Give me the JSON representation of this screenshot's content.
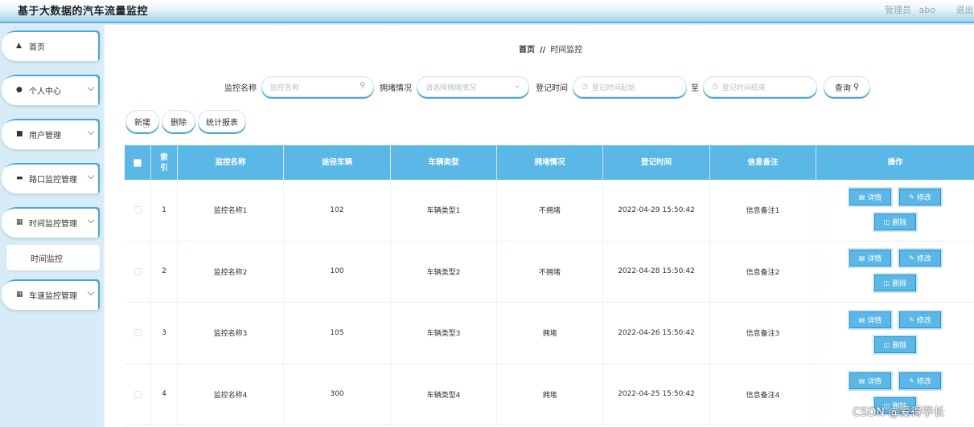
{
  "header": {
    "app_title": "基于大数据的汽车流量监控",
    "user_role": "管理员",
    "username": "abo",
    "logout": "退出登"
  },
  "sidebar": {
    "items": [
      {
        "label": "首页",
        "icon": "home-icon"
      },
      {
        "label": "个人中心",
        "icon": "person-icon"
      },
      {
        "label": "用户管理",
        "icon": "briefcase-icon"
      },
      {
        "label": "路口监控管理",
        "icon": "camera-icon"
      },
      {
        "label": "时间监控管理",
        "icon": "grid-icon"
      },
      {
        "label": "车速监控管理",
        "icon": "grid-icon"
      }
    ],
    "sub_item": "时间监控"
  },
  "breadcrumb": {
    "home": "首页",
    "separator": "//",
    "current": "时间监控"
  },
  "search": {
    "name_label": "监控名称",
    "name_placeholder": "监控名称",
    "congestion_label": "拥堵情况",
    "congestion_placeholder": "请选择拥堵情况",
    "time_label": "登记时间",
    "start_placeholder": "登记时间起始",
    "to": "至",
    "end_placeholder": "登记时间结束",
    "query": "查询"
  },
  "actions": {
    "add": "新增",
    "delete": "删除",
    "report": "统计报表"
  },
  "table": {
    "headers": [
      "索引",
      "监控名称",
      "途径车辆",
      "车辆类型",
      "拥堵情况",
      "登记时间",
      "信息备注",
      "操作"
    ],
    "rows": [
      {
        "index": "1",
        "name": "监控名称1",
        "vehicles": "102",
        "type": "车辆类型1",
        "congestion": "不拥堵",
        "time": "2022-04-29 15:50:42",
        "note": "信息备注1"
      },
      {
        "index": "2",
        "name": "监控名称2",
        "vehicles": "100",
        "type": "车辆类型2",
        "congestion": "不拥堵",
        "time": "2022-04-28 15:50:42",
        "note": "信息备注2"
      },
      {
        "index": "3",
        "name": "监控名称3",
        "vehicles": "105",
        "type": "车辆类型3",
        "congestion": "拥堵",
        "time": "2022-04-26 15:50:42",
        "note": "信息备注3"
      },
      {
        "index": "4",
        "name": "监控名称4",
        "vehicles": "300",
        "type": "车辆类型4",
        "congestion": "拥堵",
        "time": "2022-04-25 15:50:42",
        "note": "信息备注4"
      }
    ],
    "op_detail": "详情",
    "op_edit": "修改",
    "op_delete": "删除"
  },
  "watermark": "CSDN @爱得学长",
  "colors": {
    "accent": "#5bb7e5",
    "sidebar_bg": "#d8ecf7"
  }
}
